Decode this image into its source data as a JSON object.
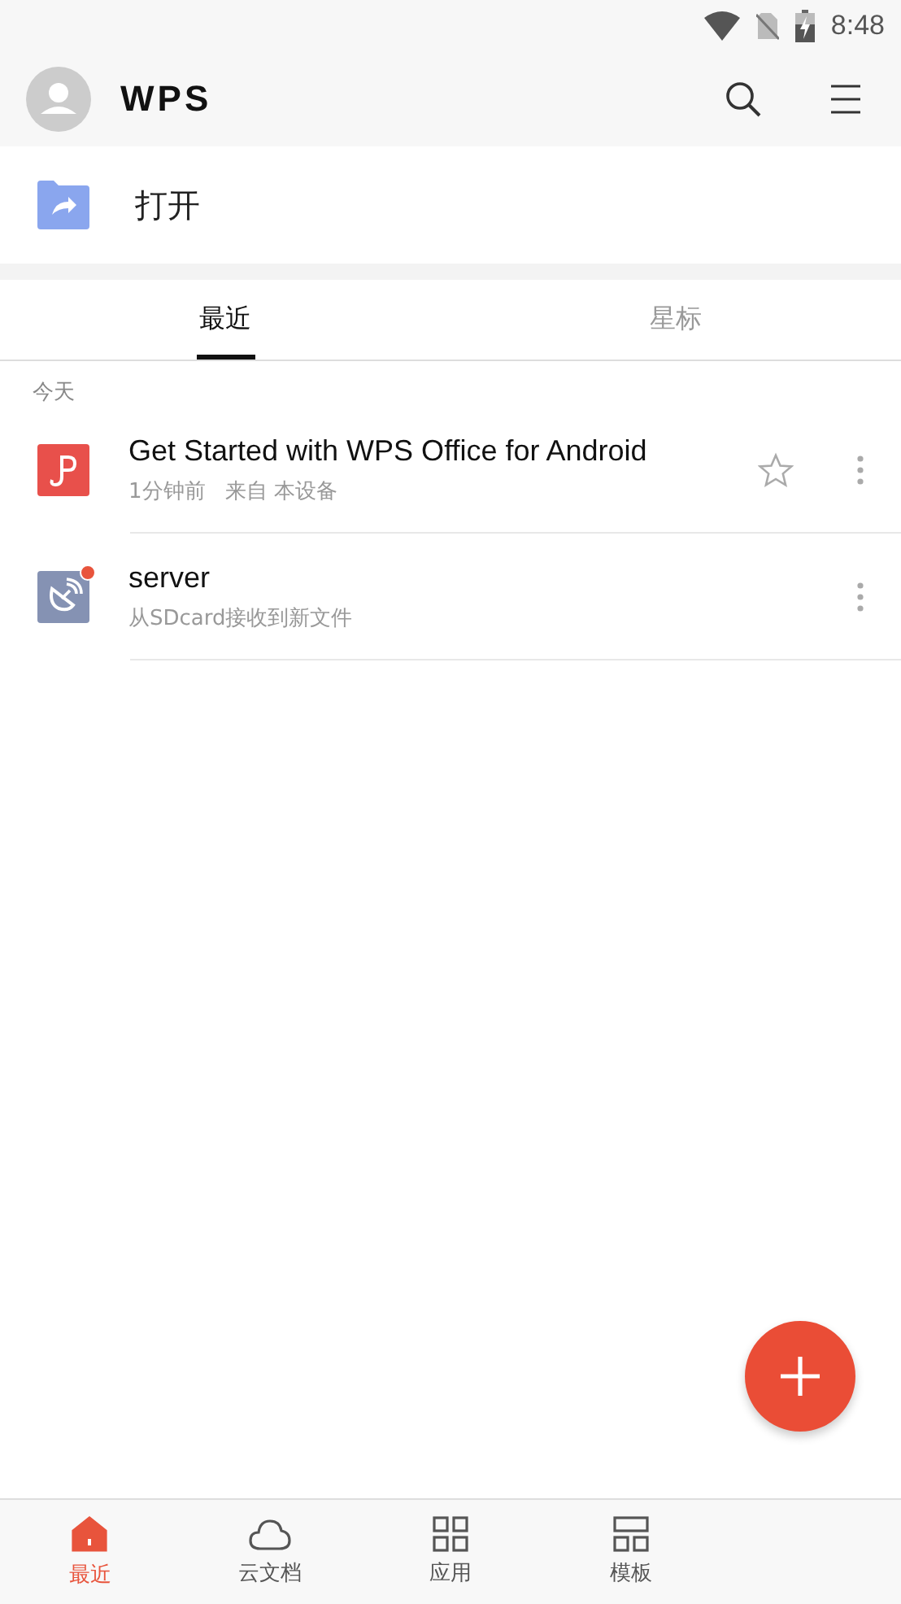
{
  "status_bar": {
    "time": "8:48"
  },
  "header": {
    "logo": "WPS"
  },
  "open_row": {
    "label": "打开"
  },
  "tabs": [
    {
      "label": "最近",
      "selected": true
    },
    {
      "label": "星标",
      "selected": false
    }
  ],
  "section": "今天",
  "files": [
    {
      "kind": "pdf",
      "name": "Get Started with WPS Office for Android",
      "meta": [
        "1分钟前",
        "来自 本设备"
      ],
      "starred": false,
      "unread": false
    },
    {
      "kind": "share",
      "name": "server",
      "meta": [
        "从SDcard接收到新文件"
      ],
      "unread": true
    }
  ],
  "nav": [
    {
      "kind": "home",
      "label": "最近",
      "selected": true
    },
    {
      "kind": "cloud",
      "label": "云文档",
      "selected": false
    },
    {
      "kind": "apps",
      "label": "应用",
      "selected": false
    },
    {
      "kind": "template",
      "label": "模板",
      "selected": false
    }
  ]
}
